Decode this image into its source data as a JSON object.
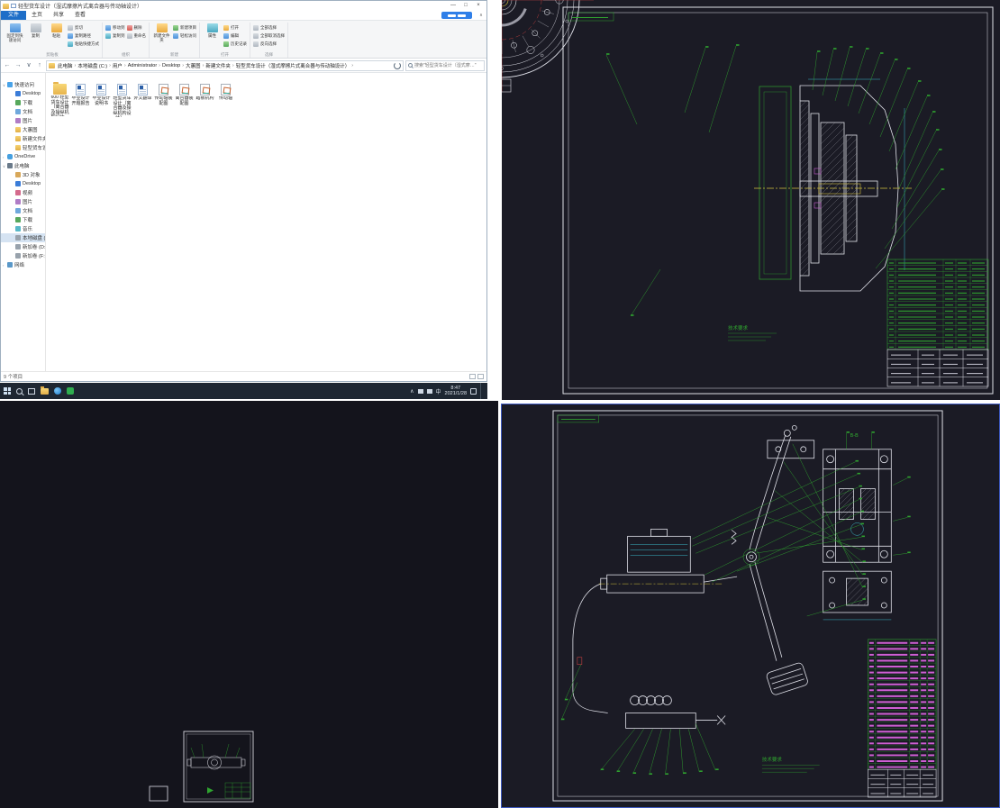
{
  "explorer": {
    "title": "轻型货车设计（湿式摩擦片式离合器与传动轴设计）",
    "controls": {
      "min": "—",
      "max": "□",
      "close": "×"
    },
    "tabs": {
      "file": "文件",
      "home": "主页",
      "share": "共享",
      "view": "查看"
    },
    "ribbon": {
      "pin": "固定到快速访问",
      "copy": "复制",
      "paste": "粘贴",
      "cut": "剪切",
      "copy_path": "复制路径",
      "paste_shortcut": "粘贴快捷方式",
      "move_to": "移动到",
      "copy_to": "复制到",
      "delete": "删除",
      "rename": "重命名",
      "new_folder": "新建文件夹",
      "new_item": "新建项目",
      "easy_access": "轻松访问",
      "properties": "属性",
      "open": "打开",
      "edit": "编辑",
      "history": "历史记录",
      "select_all": "全部选择",
      "select_none": "全部取消选择",
      "invert_selection": "反向选择",
      "groups": {
        "clipboard": "剪贴板",
        "organize": "组织",
        "new": "新建",
        "open": "打开",
        "select": "选择"
      }
    },
    "address": {
      "segments": [
        "此电脑",
        "本地磁盘 (C:)",
        "用户",
        "Administrator",
        "Desktop",
        "大蕙图",
        "新建文件夹",
        "轻型货车设计（湿式摩擦片式离合器与传动轴设计）"
      ],
      "search_text": "搜索\"轻型货车设计（湿式摩…\""
    },
    "nav": {
      "items": [
        {
          "label": "快速访问",
          "icon": "ic-quick",
          "cls": "ind0",
          "chev": "∨"
        },
        {
          "label": "Desktop",
          "icon": "ic-desktop",
          "cls": "ind1",
          "chev": ""
        },
        {
          "label": "下载",
          "icon": "ic-download",
          "cls": "ind1",
          "chev": ""
        },
        {
          "label": "文档",
          "icon": "ic-doc",
          "cls": "ind1",
          "chev": ""
        },
        {
          "label": "图片",
          "icon": "ic-pic",
          "cls": "ind1",
          "chev": ""
        },
        {
          "label": "大蕙图",
          "icon": "ic-folder",
          "cls": "ind1",
          "chev": ""
        },
        {
          "label": "新建文件夹",
          "icon": "ic-folder",
          "cls": "ind1",
          "chev": ""
        },
        {
          "label": "轻型货车设计文件",
          "icon": "ic-folder",
          "cls": "ind1",
          "chev": ""
        },
        {
          "label": "OneDrive",
          "icon": "ic-cloud",
          "cls": "ind0",
          "chev": "›"
        },
        {
          "label": "此电脑",
          "icon": "ic-pc",
          "cls": "ind0",
          "chev": "∨"
        },
        {
          "label": "3D 对象",
          "icon": "ic-folder3",
          "cls": "ind1",
          "chev": ""
        },
        {
          "label": "Desktop",
          "icon": "ic-desktop",
          "cls": "ind1",
          "chev": ""
        },
        {
          "label": "视频",
          "icon": "ic-video",
          "cls": "ind1",
          "chev": ""
        },
        {
          "label": "图片",
          "icon": "ic-pic",
          "cls": "ind1",
          "chev": ""
        },
        {
          "label": "文档",
          "icon": "ic-doc",
          "cls": "ind1",
          "chev": ""
        },
        {
          "label": "下载",
          "icon": "ic-download",
          "cls": "ind1",
          "chev": ""
        },
        {
          "label": "音乐",
          "icon": "ic-music",
          "cls": "ind1",
          "chev": ""
        },
        {
          "label": "本地磁盘 (C:)",
          "icon": "ic-drive",
          "cls": "ind1 sel",
          "chev": ""
        },
        {
          "label": "新加卷 (D:)",
          "icon": "ic-drive",
          "cls": "ind1",
          "chev": ""
        },
        {
          "label": "新加卷 (F:)",
          "icon": "ic-drive",
          "cls": "ind1",
          "chev": ""
        },
        {
          "label": "网络",
          "icon": "ic-net",
          "cls": "ind0",
          "chev": "›"
        }
      ]
    },
    "files": [
      {
        "label": "600 轻型货车设计（离合器及操纵机构设计…",
        "type": "folder"
      },
      {
        "label": "毕业设计开题报告",
        "type": "doc"
      },
      {
        "label": "毕业设计说明书",
        "type": "doc"
      },
      {
        "label": "轻型货车设计（离合器及操纵机构设计）…",
        "type": "doc"
      },
      {
        "label": "外文翻译",
        "type": "doc"
      },
      {
        "label": "传动轴装配图",
        "type": "dwg"
      },
      {
        "label": "离合器装配图",
        "type": "dwg"
      },
      {
        "label": "踏板机构",
        "type": "dwg"
      },
      {
        "label": "传动轴",
        "type": "dwg"
      }
    ],
    "status": {
      "items_text": "9 个项目"
    },
    "taskbar": {
      "lang": "中",
      "time": "8:47",
      "date": "2021/1/28"
    }
  },
  "cad_tr": {
    "tech_req": "技术要求"
  },
  "cad_br": {
    "tech_req": "技术要求",
    "view_label": "B-B"
  }
}
